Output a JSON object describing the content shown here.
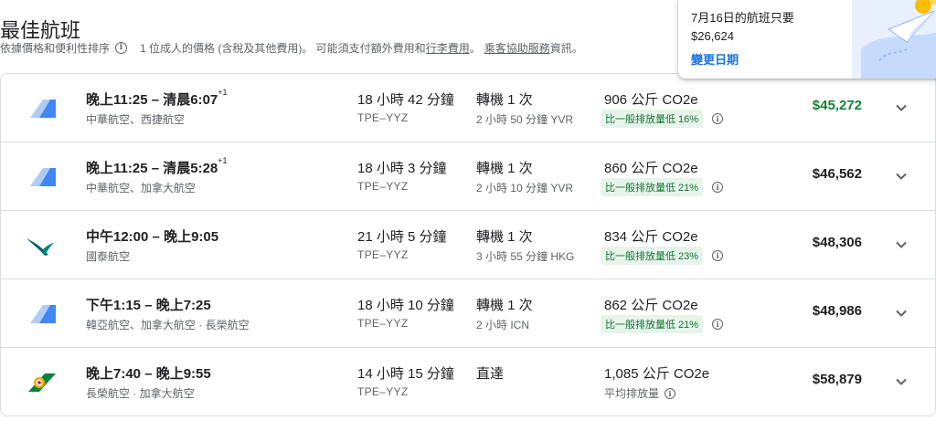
{
  "header": {
    "title": "最佳航班",
    "sort_note": "依據價格和便利性排序",
    "price_note": "1 位成人的價格 (含稅及其他費用)。 可能須支付額外費用和",
    "baggage_link": "行李費用",
    "period": "。",
    "assistance_link": "乘客協助服務",
    "assistance_suffix": "資訊。"
  },
  "popup": {
    "line1": "7月16日的航班只要",
    "line2": "$26,624",
    "link": "變更日期"
  },
  "colors": {
    "accent_blue": "#1a73e8",
    "green_price": "#188038",
    "badge_bg": "#e6f4ea",
    "badge_text": "#137333"
  },
  "flights": [
    {
      "logo": "multi-airline-logo-icon",
      "depart": "晚上11:25",
      "arrive": "清晨6:07",
      "day_offset": "+1",
      "airlines": "中華航空、西捷航空",
      "duration": "18 小時 42 分鐘",
      "route": "TPE–YYZ",
      "stops": "轉機 1 次",
      "layover": "2 小時 50 分鐘 YVR",
      "emissions": "906 公斤 CO2e",
      "emission_badge": "比一般排放量低 16%",
      "price": "$45,272"
    },
    {
      "logo": "multi-airline-logo-icon",
      "depart": "晚上11:25",
      "arrive": "清晨5:28",
      "day_offset": "+1",
      "airlines": "中華航空、加拿大航空",
      "duration": "18 小時 3 分鐘",
      "route": "TPE–YYZ",
      "stops": "轉機 1 次",
      "layover": "2 小時 10 分鐘 YVR",
      "emissions": "860 公斤 CO2e",
      "emission_badge": "比一般排放量低 21%",
      "price": "$46,562"
    },
    {
      "logo": "cathay-pacific-logo-icon",
      "depart": "中午12:00",
      "arrive": "晚上9:05",
      "day_offset": "",
      "airlines": "國泰航空",
      "duration": "21 小時 5 分鐘",
      "route": "TPE–YYZ",
      "stops": "轉機 1 次",
      "layover": "3 小時 55 分鐘 HKG",
      "emissions": "834 公斤 CO2e",
      "emission_badge": "比一般排放量低 23%",
      "price": "$48,306"
    },
    {
      "logo": "multi-airline-logo-icon",
      "depart": "下午1:15",
      "arrive": "晚上7:25",
      "day_offset": "",
      "airlines": "韓亞航空、加拿大航空 · 長榮航空",
      "duration": "18 小時 10 分鐘",
      "route": "TPE–YYZ",
      "stops": "轉機 1 次",
      "layover": "2 小時 ICN",
      "emissions": "862 公斤 CO2e",
      "emission_badge": "比一般排放量低 21%",
      "price": "$48,986"
    },
    {
      "logo": "eva-air-logo-icon",
      "depart": "晚上7:40",
      "arrive": "晚上9:55",
      "day_offset": "",
      "airlines": "長榮航空 · 加拿大航空",
      "duration": "14 小時 15 分鐘",
      "route": "TPE–YYZ",
      "stops": "直達",
      "layover": "",
      "emissions": "1,085 公斤 CO2e",
      "emission_note": "平均排放量",
      "price": "$58,879"
    }
  ]
}
